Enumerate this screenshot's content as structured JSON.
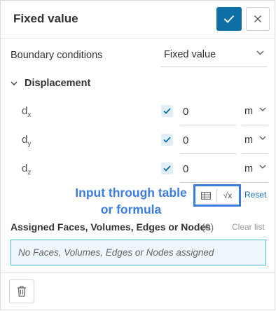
{
  "header": {
    "title": "Fixed value",
    "confirm_icon": "check-icon",
    "close_icon": "close-icon"
  },
  "boundary_conditions": {
    "label": "Boundary conditions",
    "value": "Fixed value"
  },
  "displacement": {
    "section_label": "Displacement",
    "components": [
      {
        "symbol": "d",
        "subscript": "x",
        "checked": true,
        "value": "0",
        "unit": "m"
      },
      {
        "symbol": "d",
        "subscript": "y",
        "checked": true,
        "value": "0",
        "unit": "m"
      },
      {
        "symbol": "d",
        "subscript": "z",
        "checked": true,
        "value": "0",
        "unit": "m"
      }
    ]
  },
  "annotation": {
    "line1": "Input through table",
    "line2": "or formula",
    "color": "#3b7ddd"
  },
  "input_mode": {
    "table_icon": "table-icon",
    "formula_icon": "formula-sqrt-icon",
    "formula_glyph": "√x",
    "reset_label": "Reset"
  },
  "assignment": {
    "label": "Assigned Faces, Volumes, Edges or Nodes",
    "count": "(0)",
    "clear_label": "Clear list",
    "placeholder": "No Faces, Volumes, Edges or Nodes assigned"
  },
  "footer": {
    "delete_icon": "trash-icon"
  },
  "colors": {
    "primary": "#0d6fa3",
    "accent": "#3b7ddd",
    "link": "#1a73b0",
    "assign_border": "#45bcd8"
  }
}
